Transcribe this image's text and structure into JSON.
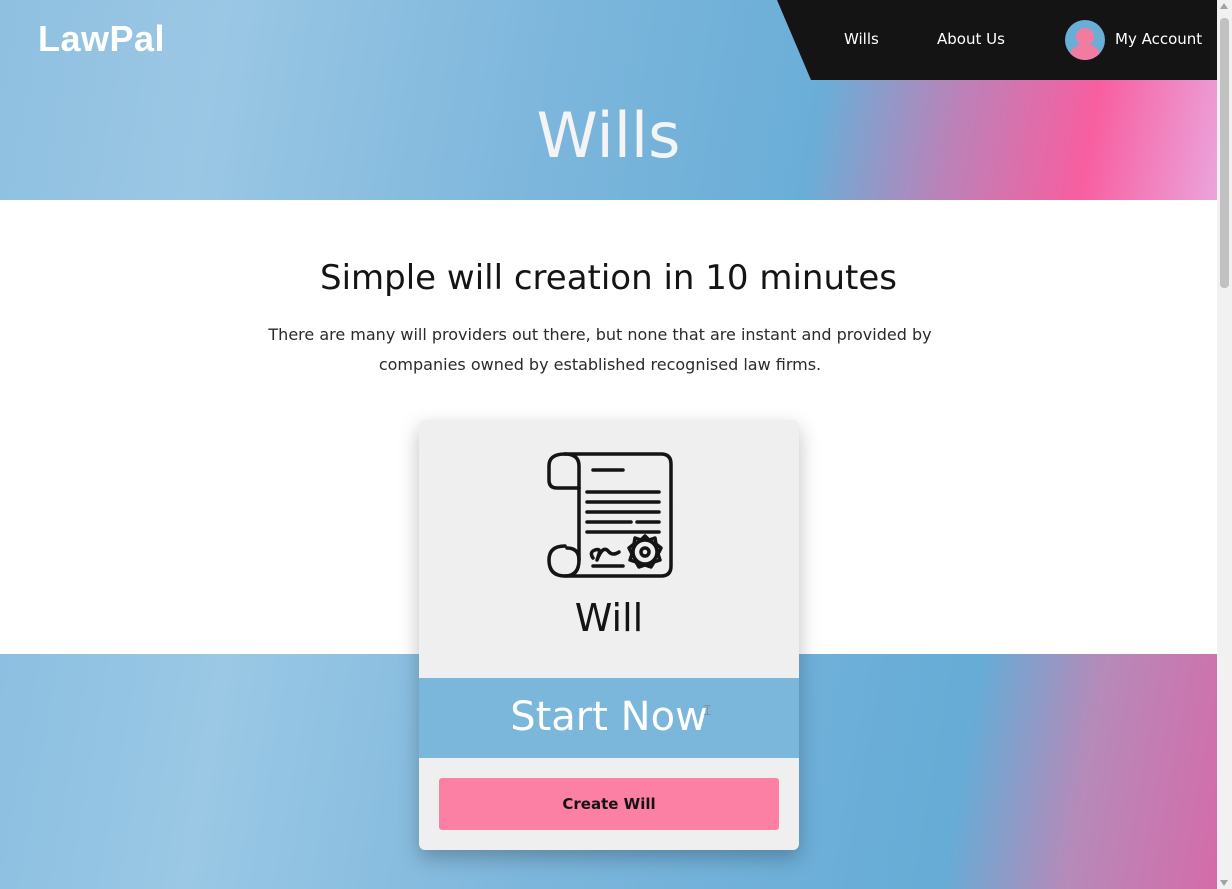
{
  "brand": {
    "logo": "LawPal"
  },
  "nav": {
    "items": [
      {
        "label": "Wills"
      },
      {
        "label": "About Us"
      }
    ],
    "account_label": "My Account"
  },
  "hero": {
    "title": "Wills"
  },
  "intro": {
    "heading": "Simple will creation in 10 minutes",
    "text": "There are many will providers out there, but none that are instant and provided by companies owned by established recognised law firms."
  },
  "card": {
    "icon": "will-scroll-icon",
    "title": "Will",
    "band_text": "Start Now",
    "button_label": "Create Will"
  },
  "colors": {
    "nav_bg": "#141414",
    "accent_pink": "#fc80a3",
    "accent_blue": "#7bb6db",
    "card_bg": "#efefef"
  }
}
